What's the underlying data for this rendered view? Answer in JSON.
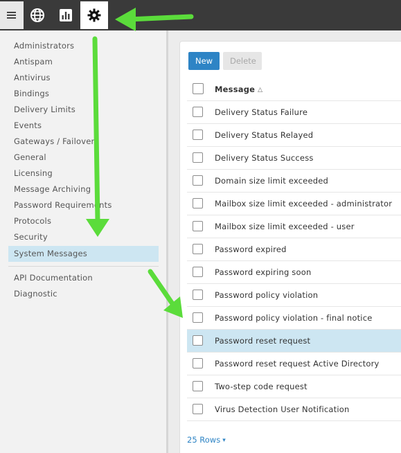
{
  "topbar": {
    "icons": [
      "menu-icon",
      "globe-icon",
      "bar-chart-icon",
      "gear-icon"
    ],
    "active": "gear-icon"
  },
  "sidebar": {
    "items": [
      {
        "label": "Administrators"
      },
      {
        "label": "Antispam"
      },
      {
        "label": "Antivirus"
      },
      {
        "label": "Bindings"
      },
      {
        "label": "Delivery Limits"
      },
      {
        "label": "Events"
      },
      {
        "label": "Gateways / Failover"
      },
      {
        "label": "General"
      },
      {
        "label": "Licensing"
      },
      {
        "label": "Message Archiving"
      },
      {
        "label": "Password Requirements"
      },
      {
        "label": "Protocols"
      },
      {
        "label": "Security"
      },
      {
        "label": "System Messages"
      }
    ],
    "active": "System Messages",
    "secondary_items": [
      {
        "label": "API Documentation"
      },
      {
        "label": "Diagnostic"
      }
    ]
  },
  "toolbar": {
    "new_label": "New",
    "delete_label": "Delete"
  },
  "table": {
    "column_header": "Message",
    "sort_indicator": "△",
    "rows": [
      {
        "label": "Delivery Status Failure"
      },
      {
        "label": "Delivery Status Relayed"
      },
      {
        "label": "Delivery Status Success"
      },
      {
        "label": "Domain size limit exceeded"
      },
      {
        "label": "Mailbox size limit exceeded - administrator"
      },
      {
        "label": "Mailbox size limit exceeded - user"
      },
      {
        "label": "Password expired"
      },
      {
        "label": "Password expiring soon"
      },
      {
        "label": "Password policy violation"
      },
      {
        "label": "Password policy violation - final notice"
      },
      {
        "label": "Password reset request"
      },
      {
        "label": "Password reset request Active Directory"
      },
      {
        "label": "Two-step code request"
      },
      {
        "label": "Virus Detection User Notification"
      }
    ],
    "selected_row": "Password reset request"
  },
  "footer": {
    "rows_label": "25 Rows",
    "caret": "▾"
  },
  "colors": {
    "accent": "#2e84c5",
    "selection": "#cde6f2",
    "topbar": "#3a3a3a",
    "arrow": "#5bdc3b"
  }
}
